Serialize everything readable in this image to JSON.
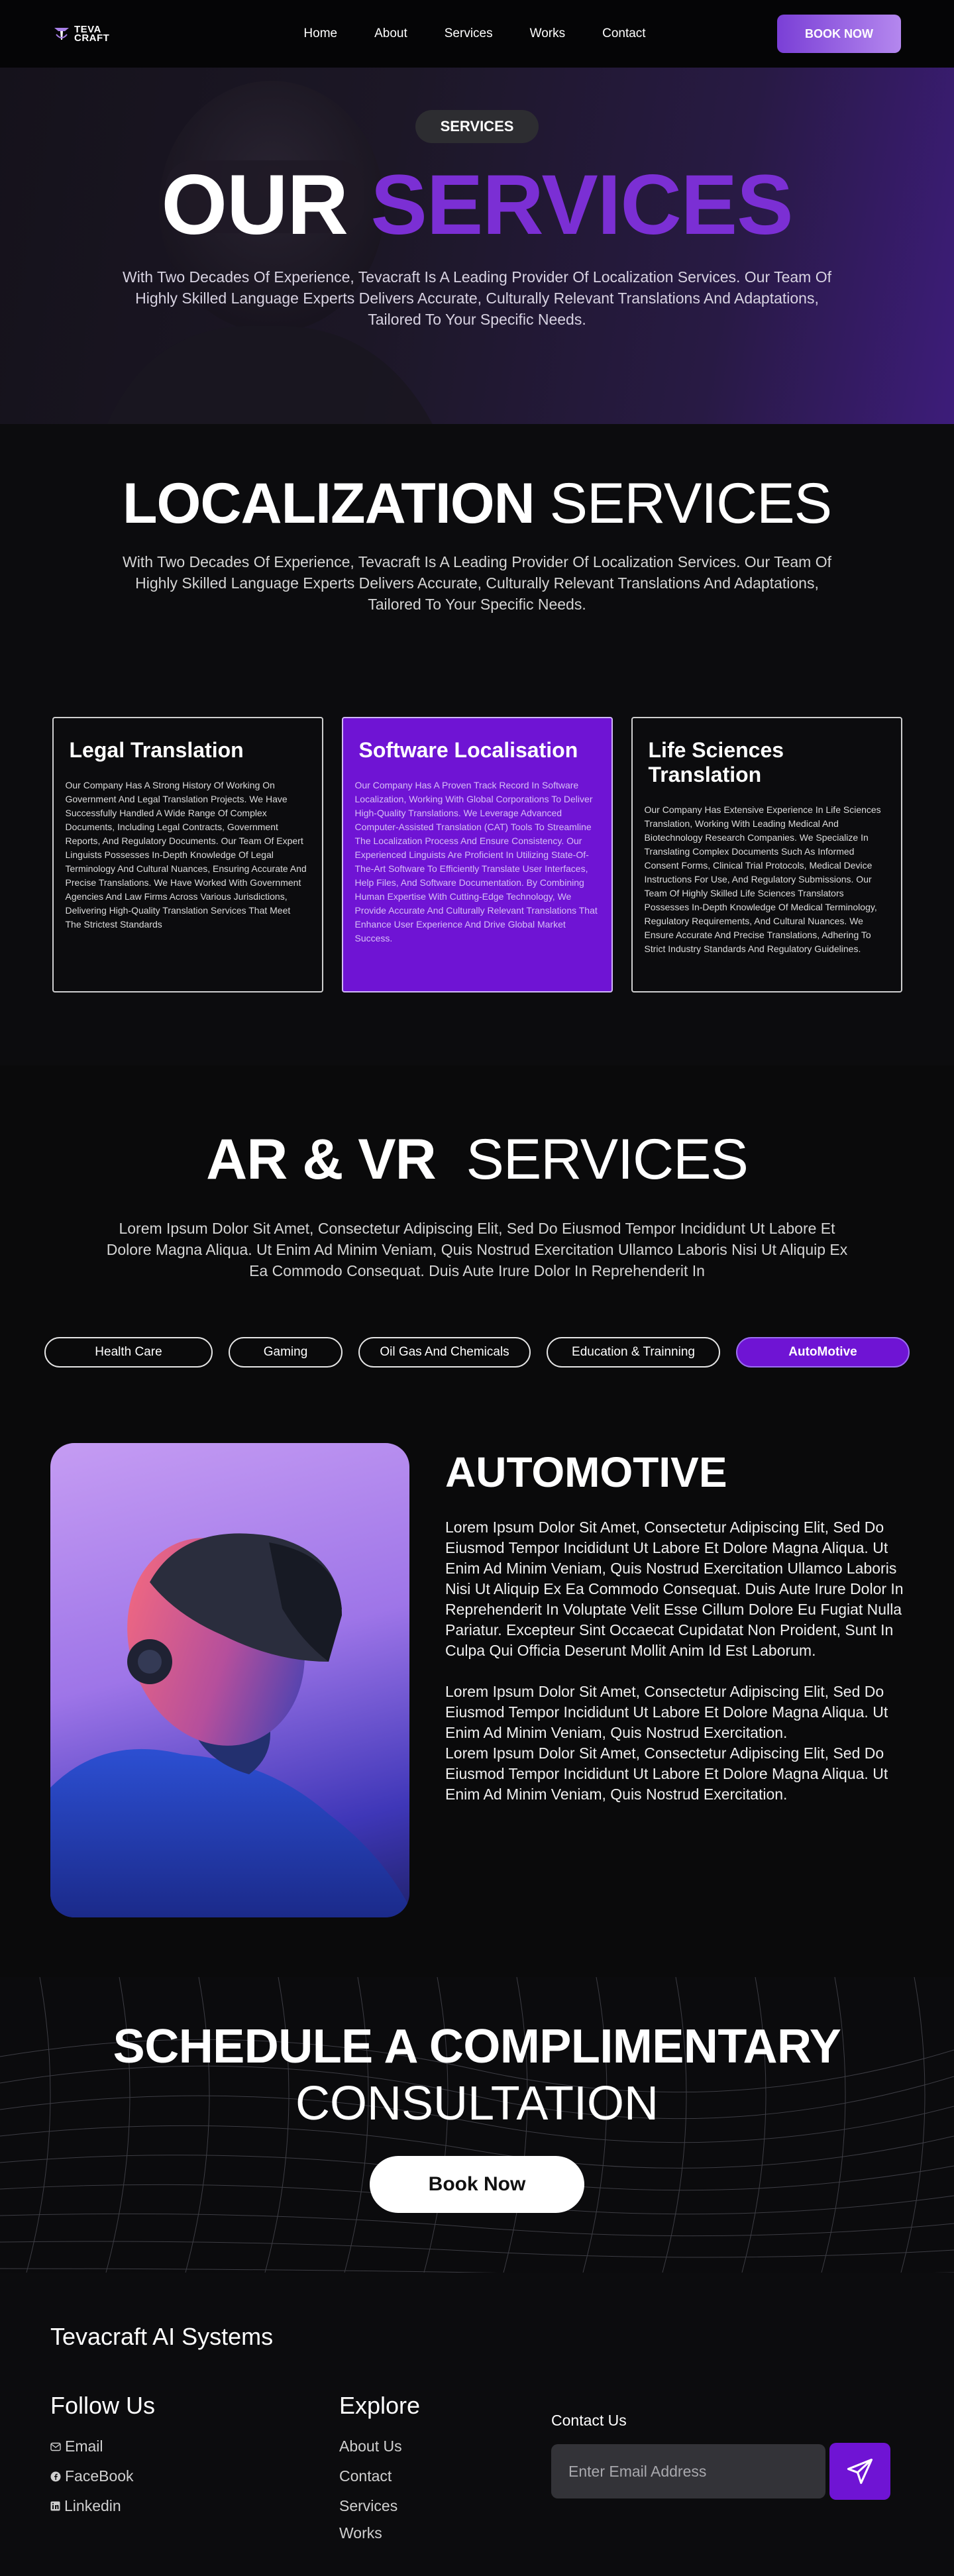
{
  "nav": {
    "logo_text_line1": "TEVA",
    "logo_text_line2": "CRAFT",
    "links": [
      "Home",
      "About",
      "Services",
      "Works",
      "Contact"
    ],
    "cta": "BOOK NOW"
  },
  "hero": {
    "badge": "SERVICES",
    "title_part1": "OUR",
    "title_part2": "SERVICES",
    "description": "With Two Decades Of Experience, Tevacraft Is A Leading Provider Of Localization Services. Our Team Of Highly Skilled Language Experts Delivers Accurate, Culturally Relevant Translations And Adaptations, Tailored To Your Specific Needs."
  },
  "localization": {
    "title_bold": "LOCALIZATION",
    "title_light": "SERVICES",
    "description": "With Two Decades Of Experience, Tevacraft Is A Leading Provider Of Localization Services. Our Team Of Highly Skilled Language Experts Delivers Accurate, Culturally Relevant Translations And Adaptations, Tailored To Your Specific Needs.",
    "cards": [
      {
        "title": "Legal Translation",
        "text": "Our Company Has A Strong History Of Working On Government And Legal Translation Projects. We Have Successfully Handled A Wide Range Of Complex Documents, Including Legal Contracts, Government Reports, And Regulatory Documents. Our Team Of Expert Linguists Possesses In-Depth Knowledge Of Legal Terminology And Cultural Nuances, Ensuring Accurate And Precise Translations. We Have Worked With Government Agencies And Law Firms Across Various Jurisdictions, Delivering High-Quality Translation Services That Meet The Strictest Standards"
      },
      {
        "title": "Software Localisation",
        "text": "Our Company Has A Proven Track Record In Software Localization, Working With Global Corporations To Deliver High-Quality Translations. We Leverage Advanced Computer-Assisted Translation (CAT) Tools To Streamline The Localization Process And Ensure Consistency. Our Experienced Linguists Are Proficient In Utilizing State-Of-The-Art Software To Efficiently Translate User Interfaces, Help Files, And Software Documentation. By Combining Human Expertise With Cutting-Edge Technology, We Provide Accurate And Culturally Relevant Translations That Enhance User Experience And Drive Global Market Success."
      },
      {
        "title": "Life Sciences Translation",
        "text": "Our Company Has Extensive Experience In Life Sciences Translation, Working With Leading Medical And Biotechnology Research Companies. We Specialize In Translating Complex Documents Such As Informed Consent Forms, Clinical Trial Protocols, Medical Device Instructions For Use, And Regulatory Submissions. Our Team Of Highly Skilled Life Sciences Translators Possesses In-Depth Knowledge Of Medical Terminology, Regulatory Requirements, And Cultural Nuances. We Ensure Accurate And Precise Translations, Adhering To Strict Industry Standards And Regulatory Guidelines."
      }
    ]
  },
  "arvr": {
    "title_bold": "AR & VR",
    "title_light": "SERVICES",
    "description": "Lorem Ipsum Dolor Sit Amet, Consectetur Adipiscing Elit, Sed Do Eiusmod Tempor Incididunt Ut Labore Et Dolore Magna Aliqua. Ut Enim Ad Minim Veniam, Quis Nostrud Exercitation Ullamco Laboris Nisi Ut Aliquip Ex Ea Commodo Consequat. Duis Aute Irure Dolor In Reprehenderit In",
    "tabs": [
      "Health Care",
      "Gaming",
      "Oil Gas And Chemicals",
      "Education & Trainning",
      "AutoMotive"
    ],
    "active_tab": "AutoMotive",
    "detail_title": "AUTOMOTIVE",
    "detail_p1": "Lorem Ipsum Dolor Sit Amet, Consectetur Adipiscing Elit, Sed Do Eiusmod Tempor Incididunt Ut Labore Et Dolore Magna Aliqua. Ut Enim Ad Minim Veniam, Quis Nostrud Exercitation Ullamco Laboris Nisi Ut Aliquip Ex Ea Commodo Consequat. Duis Aute Irure Dolor In Reprehenderit In Voluptate Velit Esse Cillum Dolore Eu Fugiat Nulla Pariatur. Excepteur Sint Occaecat Cupidatat Non Proident, Sunt In Culpa Qui Officia Deserunt Mollit Anim Id Est Laborum.",
    "detail_p2": "Lorem Ipsum Dolor Sit Amet, Consectetur Adipiscing Elit, Sed Do Eiusmod Tempor Incididunt Ut Labore Et Dolore Magna Aliqua. Ut Enim Ad Minim Veniam, Quis Nostrud Exercitation.",
    "detail_p3": "Lorem Ipsum Dolor Sit Amet, Consectetur Adipiscing Elit, Sed Do Eiusmod Tempor Incididunt Ut Labore Et Dolore Magna Aliqua. Ut Enim Ad Minim Veniam, Quis Nostrud Exercitation."
  },
  "schedule": {
    "line1": "SCHEDULE A COMPLIMENTARY",
    "line2": "CONSULTATION",
    "button": "Book Now"
  },
  "footer": {
    "brand": "Tevacraft AI Systems",
    "follow_heading": "Follow Us",
    "follow_items": [
      {
        "label": "Email",
        "icon": "mail-icon"
      },
      {
        "label": "FaceBook",
        "icon": "facebook-icon"
      },
      {
        "label": "Linkedin",
        "icon": "linkedin-icon"
      }
    ],
    "explore_heading": "Explore",
    "explore_items": [
      "About Us",
      "Contact",
      "Services",
      "Works"
    ],
    "contact_label": "Contact Us",
    "email_placeholder": "Enter Email Address"
  },
  "colors": {
    "accent": "#6f14d4",
    "accent_light": "#b487ee",
    "background": "#0a0a0c"
  }
}
